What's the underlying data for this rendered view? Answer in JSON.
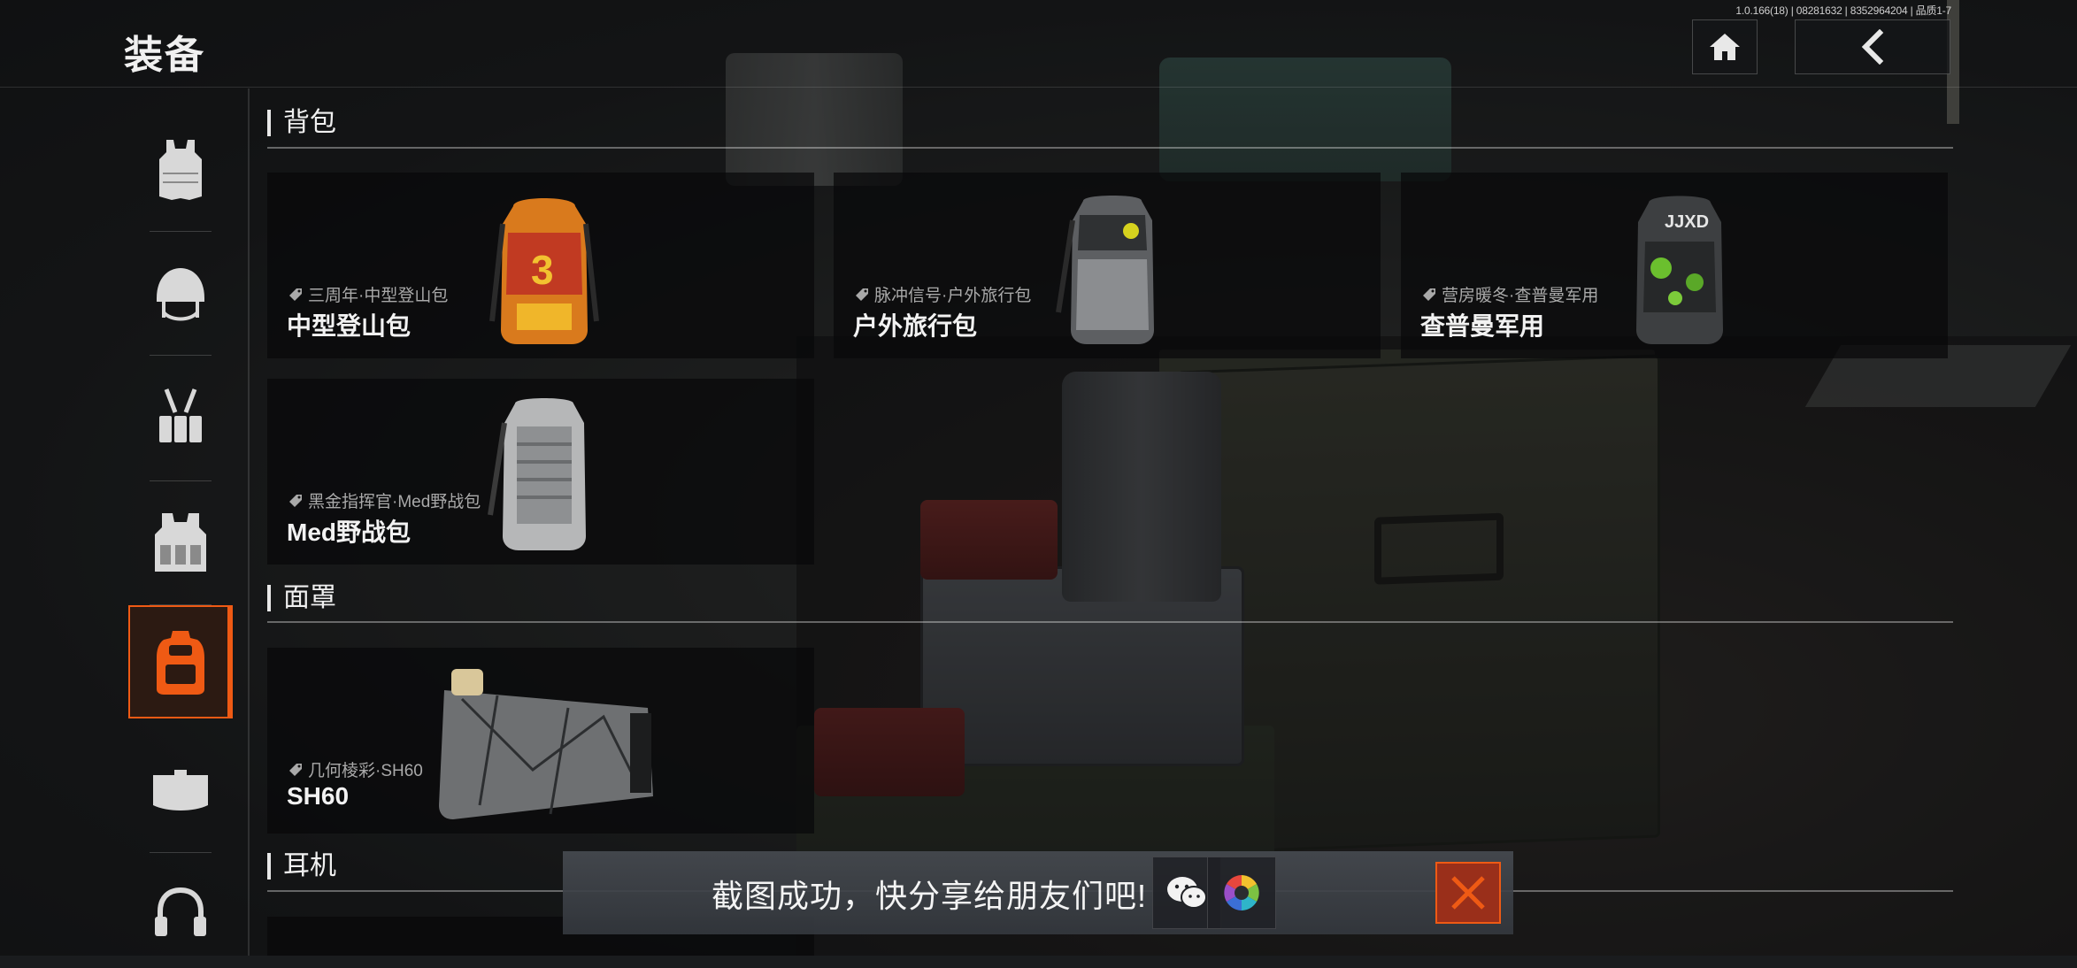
{
  "header": {
    "title": "装备",
    "version": "1.0.166(18) | 08281632 | 8352964204 | 品质1-7"
  },
  "nav": {
    "items": [
      {
        "name": "armor-vest",
        "active": false
      },
      {
        "name": "helmet",
        "active": false
      },
      {
        "name": "harness",
        "active": false
      },
      {
        "name": "plate-carrier",
        "active": false
      },
      {
        "name": "backpack",
        "active": true
      },
      {
        "name": "mask",
        "active": false
      },
      {
        "name": "headset",
        "active": false
      }
    ]
  },
  "sections": {
    "backpack": {
      "title": "背包",
      "items": [
        {
          "tag": "三周年·中型登山包",
          "name": "中型登山包"
        },
        {
          "tag": "脉冲信号·户外旅行包",
          "name": "户外旅行包"
        },
        {
          "tag": "营房暖冬·查普曼军用",
          "name": "查普曼军用"
        },
        {
          "tag": "黑金指挥官·Med野战包",
          "name": "Med野战包"
        }
      ]
    },
    "mask": {
      "title": "面罩",
      "items": [
        {
          "tag": "几何棱彩·SH60",
          "name": "SH60"
        }
      ]
    },
    "headset": {
      "title": "耳机"
    }
  },
  "toast": {
    "text": "截图成功，快分享给朋友们吧!"
  },
  "colors": {
    "accent": "#ef5a14",
    "card_bg": "#08090a",
    "toast_bg": "#464a50"
  }
}
